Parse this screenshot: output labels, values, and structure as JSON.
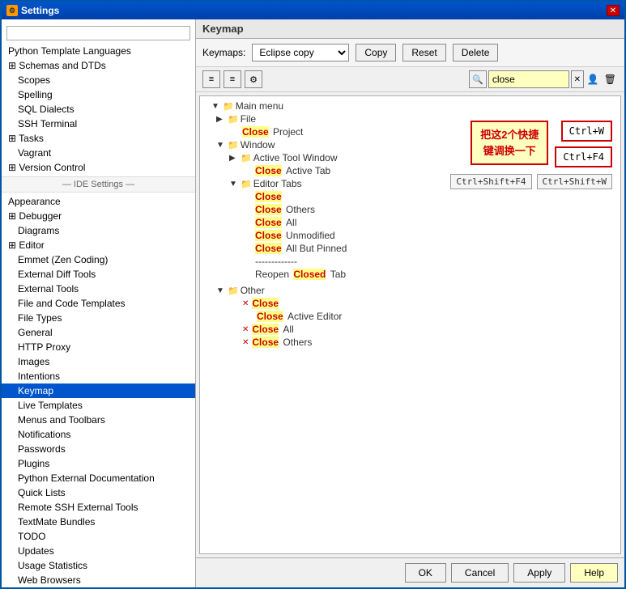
{
  "window": {
    "title": "Settings",
    "icon": "⚙"
  },
  "panel_title": "Keymap",
  "toolbar": {
    "keymaps_label": "Keymaps:",
    "keymap_value": "Eclipse copy",
    "copy_btn": "Copy",
    "reset_btn": "Reset",
    "delete_btn": "Delete"
  },
  "search": {
    "placeholder": "close",
    "value": "close"
  },
  "sidebar": {
    "search_placeholder": "",
    "items": [
      {
        "label": "Python Template Languages",
        "indent": 0
      },
      {
        "label": "Schemas and DTDs",
        "indent": 0,
        "hasPlus": true
      },
      {
        "label": "Scopes",
        "indent": 1
      },
      {
        "label": "Spelling",
        "indent": 1
      },
      {
        "label": "SQL Dialects",
        "indent": 1
      },
      {
        "label": "SSH Terminal",
        "indent": 1
      },
      {
        "label": "Tasks",
        "indent": 0,
        "hasPlus": true
      },
      {
        "label": "Vagrant",
        "indent": 1
      },
      {
        "label": "Version Control",
        "indent": 0,
        "hasPlus": true
      },
      {
        "label": "— IDE Settings —",
        "section": true
      },
      {
        "label": "Appearance",
        "indent": 0
      },
      {
        "label": "Debugger",
        "indent": 0,
        "hasPlus": true
      },
      {
        "label": "Diagrams",
        "indent": 1
      },
      {
        "label": "Editor",
        "indent": 0,
        "hasPlus": true
      },
      {
        "label": "Emmet (Zen Coding)",
        "indent": 1
      },
      {
        "label": "External Diff Tools",
        "indent": 1
      },
      {
        "label": "External Tools",
        "indent": 1
      },
      {
        "label": "File and Code Templates",
        "indent": 1
      },
      {
        "label": "File Types",
        "indent": 1
      },
      {
        "label": "General",
        "indent": 1
      },
      {
        "label": "HTTP Proxy",
        "indent": 1
      },
      {
        "label": "Images",
        "indent": 1
      },
      {
        "label": "Intentions",
        "indent": 1
      },
      {
        "label": "Keymap",
        "indent": 1,
        "selected": true
      },
      {
        "label": "Live Templates",
        "indent": 1
      },
      {
        "label": "Menus and Toolbars",
        "indent": 1
      },
      {
        "label": "Notifications",
        "indent": 1
      },
      {
        "label": "Passwords",
        "indent": 1
      },
      {
        "label": "Plugins",
        "indent": 1
      },
      {
        "label": "Python External Documentation",
        "indent": 1
      },
      {
        "label": "Quick Lists",
        "indent": 1
      },
      {
        "label": "Remote SSH External Tools",
        "indent": 1
      },
      {
        "label": "TextMate Bundles",
        "indent": 1
      },
      {
        "label": "TODO",
        "indent": 1
      },
      {
        "label": "Updates",
        "indent": 1
      },
      {
        "label": "Usage Statistics",
        "indent": 1
      },
      {
        "label": "Web Browsers",
        "indent": 1
      }
    ]
  },
  "tree": {
    "main_menu": "Main menu",
    "file": "File",
    "close_project": "Close Project",
    "window": "Window",
    "active_tool_window": "Active Tool Window",
    "close_active_tab": "Close Active Tab",
    "editor_tabs": "Editor Tabs",
    "close": "Close",
    "close_others": "Close Others",
    "close_all": "Close All",
    "close_unmodified": "Close Unmodified",
    "close_all_but_pinned": "Close All But Pinned",
    "separator": "-------------",
    "reopen_closed_tab": "Reopen Closed Tab",
    "other": "Other",
    "other_close": "Close",
    "close_active_editor": "Close Active Editor",
    "close_all2": "Close All",
    "close_others2": "Close Others"
  },
  "annotation": {
    "text": "把这2个快捷\n键调换一下",
    "shortcut1": "Ctrl+W",
    "shortcut2": "Ctrl+F4",
    "shortcut3": "Ctrl+Shift+F4",
    "shortcut4": "Ctrl+Shift+W"
  },
  "buttons": {
    "ok": "OK",
    "cancel": "Cancel",
    "apply": "Apply",
    "help": "Help"
  }
}
